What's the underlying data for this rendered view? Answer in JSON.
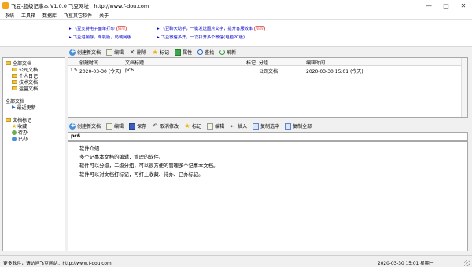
{
  "window": {
    "title": "飞豆-超级记事本 V1.0.0   飞豆网址：http://www.f-dou.com",
    "controls": [
      "—",
      "□",
      "✕"
    ]
  },
  "menu": [
    "系统",
    "工具箱",
    "数据库",
    "飞豆其它软件",
    "关于"
  ],
  "banner": {
    "promos": [
      {
        "text": "飞豆支持电子面单打印",
        "badge": "NEW"
      },
      {
        "text": "飞豆进销存，单机版，局域网版",
        "badge": ""
      },
      {
        "text": "飞豆聊天助手，一键发送图片文字，提升客服效率",
        "badge": "NEW"
      },
      {
        "text": "飞豆微信多开，一次打开多个微信(电脑PC版)",
        "badge": ""
      }
    ]
  },
  "top_toolbar": [
    "创建新文档",
    "编辑",
    "删除",
    "标记",
    "属性",
    "查找",
    "刷新"
  ],
  "sidebar": {
    "groups": [
      {
        "label": "全部文档",
        "children": [
          "公司文档",
          "个人日记",
          "技术文档",
          "运营文档"
        ]
      },
      {
        "label": "全部文档",
        "children": [
          "最近更新"
        ]
      },
      {
        "label": "文档标记",
        "children": [
          "收藏",
          "待办",
          "已办"
        ]
      }
    ]
  },
  "grid": {
    "columns": [
      "创建时间",
      "文档标题",
      "标记",
      "分组",
      "编辑时间"
    ],
    "rows": [
      {
        "index": "1",
        "created": "2020-03-30 (今天)",
        "title": "pc6",
        "mark": "",
        "group": "公司文档",
        "edited": "2020-03-30 15:01 (今天)"
      }
    ]
  },
  "bottom_toolbar": [
    "创建新文档",
    "编辑",
    "保存",
    "取消修改",
    "标记",
    "编辑",
    "插入",
    "复制选中",
    "复制全部"
  ],
  "document": {
    "title": "pc6",
    "lines": [
      "软件介绍",
      "多个记事本文档的编辑，管理的软件。",
      "软件可以分级，二级分组，可以很方便的管理多个记事本文档。",
      "软件可以对文档打标记，可打上收藏、待办、已办标记。"
    ]
  },
  "status": {
    "left": "更多软件，请访问飞豆网站：http://www.f-dou.com",
    "right": "2020-03-30 15:01 星期一"
  },
  "colors": {
    "promo_text": "#0000cc",
    "badge": "#e06b6b",
    "folder": "#f0c64a",
    "star": "#e8b300"
  }
}
